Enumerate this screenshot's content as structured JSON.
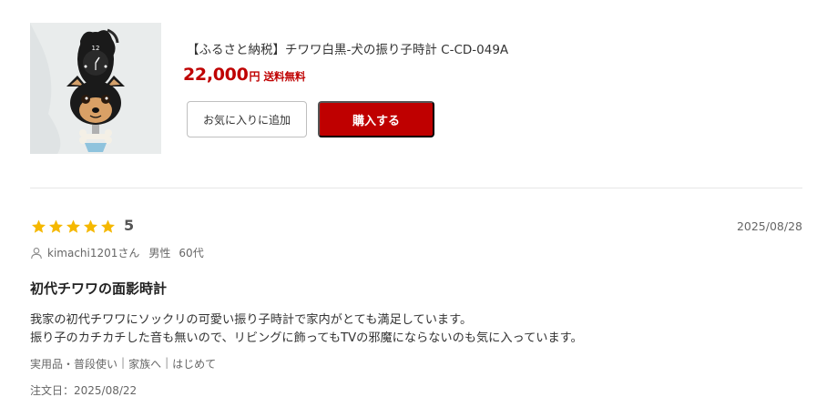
{
  "product": {
    "title": "【ふるさと納税】チワワ白黒-犬の振り子時計 C-CD-049A",
    "price": "22,000",
    "currency": "円",
    "shipping": "送料無料",
    "favorite_label": "お気に入りに追加",
    "buy_label": "購入する"
  },
  "review": {
    "rating": 5,
    "rating_text": "5",
    "date": "2025/08/28",
    "reviewer_name": "kimachi1201さん",
    "reviewer_gender": "男性",
    "reviewer_age": "60代",
    "title": "初代チワワの面影時計",
    "body": [
      "我家の初代チワワにソックリの可愛い振り子時計で家内がとても満足しています。",
      "振り子のカチカチした音も無いので、リビングに飾ってもTVの邪魔にならないのも気に入っています。"
    ],
    "tags": [
      "実用品・普段使い",
      "家族へ",
      "はじめて"
    ],
    "order_date": "注文日：2025/08/22"
  },
  "colors": {
    "accent": "#bf0000",
    "star": "#f5b800"
  }
}
